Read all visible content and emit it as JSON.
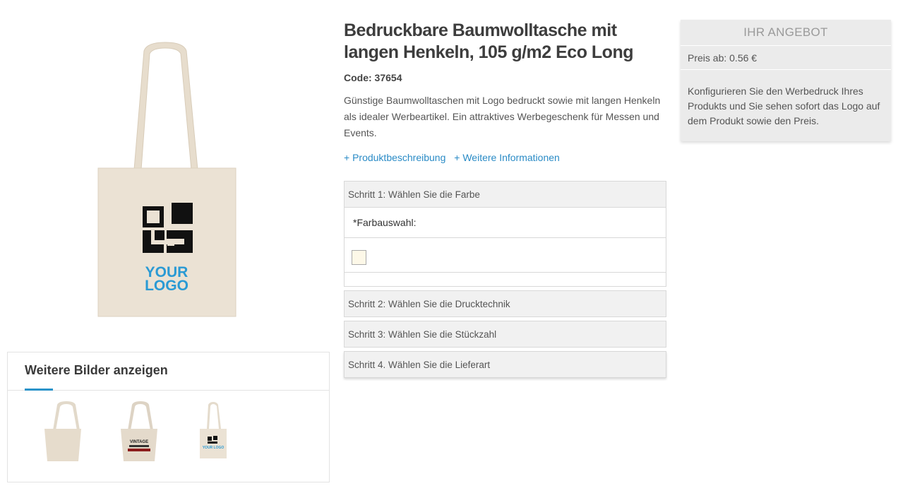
{
  "product": {
    "title": "Bedruckbare Baumwolltasche mit langen Henkeln, 105 g/m2 Eco Long",
    "code": "Code: 37654",
    "description": "Günstige Baumwolltaschen mit Logo bedruckt sowie mit langen Henkeln als idealer Werbeartikel. Ein attraktives Werbegeschenk für Messen und Events.",
    "links": {
      "description": "+ Produktbeschreibung",
      "more_info": "+ Weitere Informationen"
    }
  },
  "image_logo": {
    "line1": "YOUR",
    "line2": "LOGO",
    "color": "#2a9ad4"
  },
  "gallery": {
    "title": "Weitere Bilder anzeigen",
    "thumb_logo": "YOUR LOGO",
    "thumb_print_text": "VINTAGE"
  },
  "steps": {
    "step1": "Schritt 1: Wählen Sie die Farbe",
    "color_label": "*Farbauswahl:",
    "step2": "Schritt 2: Wählen Sie die Drucktechnik",
    "step3": "Schritt 3: Wählen Sie die Stückzahl",
    "step4": "Schritt 4. Wählen Sie die Lieferart"
  },
  "offer": {
    "title": "IHR ANGEBOT",
    "price": "Preis ab: 0.56 €",
    "info": "Konfigurieren Sie den Werbedruck Ihres Produkts und Sie sehen sofort das Logo auf dem Produkt sowie den Preis."
  },
  "colors": {
    "accent": "#2a8bc6",
    "bag": "#ebe2d4",
    "swatch": "#fdf8e8"
  }
}
